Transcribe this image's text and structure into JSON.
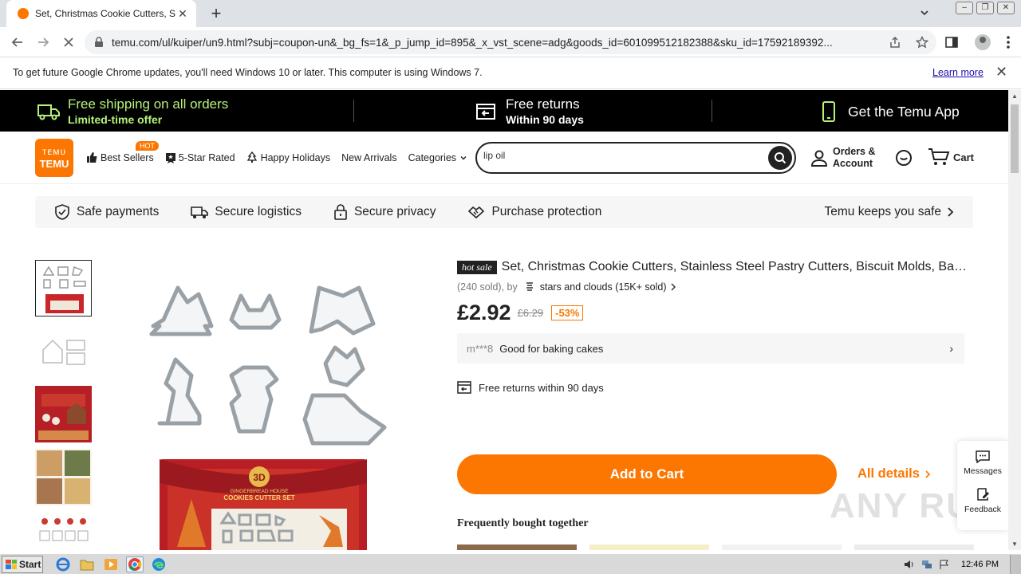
{
  "browser": {
    "tab_title": "Set, Christmas Cookie Cutters, Stainless",
    "url": "temu.com/ul/kuiper/un9.html?subj=coupon-un&_bg_fs=1&_p_jump_id=895&_x_vst_scene=adg&goods_id=601099512182388&sku_id=17592189392...",
    "infobar_text": "To get future Google Chrome updates, you'll need Windows 10 or later. This computer is using Windows 7.",
    "infobar_link": "Learn more"
  },
  "banner": {
    "shipping_line1": "Free shipping on all orders",
    "shipping_line2": "Limited-time offer",
    "returns_line1": "Free returns",
    "returns_line2": "Within 90 days",
    "app_label": "Get the Temu App"
  },
  "header": {
    "logo_top": "ᴛᴇᴍᴜ",
    "logo_bottom": "TEMU",
    "nav": {
      "best_sellers": "Best Sellers",
      "hot_badge": "HOT",
      "five_star": "5-Star Rated",
      "holidays": "Happy Holidays",
      "new_arrivals": "New Arrivals",
      "categories": "Categories"
    },
    "search_value": "lip oil",
    "account_line1": "Orders &",
    "account_line2": "Account",
    "cart_label": "Cart"
  },
  "safety": {
    "payments": "Safe payments",
    "logistics": "Secure logistics",
    "privacy": "Secure privacy",
    "protection": "Purchase protection",
    "keeps_safe": "Temu keeps you safe"
  },
  "product": {
    "badge": "hot sale",
    "title": "Set, Christmas Cookie Cutters, Stainless Steel Pastry Cutters, Biscuit Molds, Bakin...",
    "sold": "(240 sold), by",
    "store": "stars and clouds (15K+ sold)",
    "price": "£2.92",
    "old_price": "£6.29",
    "discount": "-53%",
    "review_user": "m***8",
    "review_text": "Good for baking cakes",
    "returns": "Free returns within 90 days",
    "add_to_cart": "Add to Cart",
    "all_details": "All details",
    "box_title": "3D",
    "box_sub": "COOKIES CUTTER SET",
    "box_sub2": "GINGERBREAD HOUSE"
  },
  "fbt_heading": "Frequently bought together",
  "side_widget": {
    "messages": "Messages",
    "feedback": "Feedback"
  },
  "watermark": "ANY RUN",
  "taskbar": {
    "start": "Start",
    "time": "12:46 PM"
  },
  "colors": {
    "brand_orange": "#fb7701",
    "banner_green": "#b7f279",
    "banner_bg": "#000000"
  }
}
